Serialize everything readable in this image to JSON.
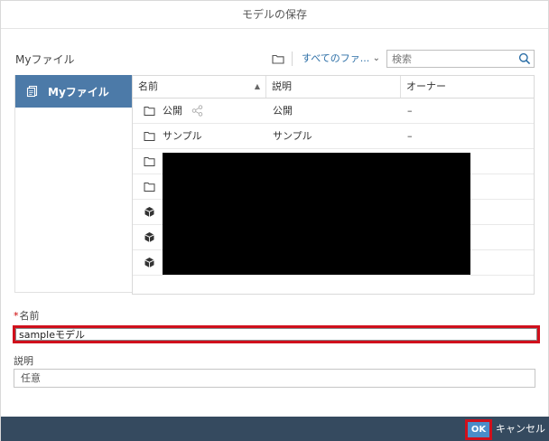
{
  "dialog": {
    "title": "モデルの保存"
  },
  "toolbar": {
    "location_label": "Myファイル",
    "filter_label": "すべてのファ...",
    "search_placeholder": "検索"
  },
  "sidebar": {
    "items": [
      {
        "label": "Myファイル",
        "icon": "document-icon",
        "selected": true
      }
    ]
  },
  "table": {
    "columns": [
      "名前",
      "説明",
      "オーナー"
    ],
    "rows": [
      {
        "icon": "folder-icon",
        "name": "公開",
        "shared": true,
        "description": "公開",
        "owner": "–"
      },
      {
        "icon": "folder-icon",
        "name": "サンプル",
        "shared": false,
        "description": "サンプル",
        "owner": "–"
      },
      {
        "icon": "folder-icon",
        "name": "",
        "description": "",
        "owner": ""
      },
      {
        "icon": "folder-icon",
        "name": "",
        "description": "",
        "owner": ""
      },
      {
        "icon": "model-cube-icon",
        "name": "",
        "description": "",
        "owner": ""
      },
      {
        "icon": "model-cube-icon",
        "name": "",
        "description": "",
        "owner": ""
      },
      {
        "icon": "model-cube-icon",
        "name": "",
        "description": "",
        "owner": ""
      }
    ]
  },
  "form": {
    "name_label": "名前",
    "required_mark": "*",
    "name_value": "sampleモデル",
    "description_label": "説明",
    "description_placeholder": "任意"
  },
  "footer": {
    "ok_label": "OK",
    "cancel_label": "キャンセル"
  },
  "colors": {
    "selected_sidebar": "#4c7aa8",
    "footer_bg": "#354a5f",
    "ok_button": "#4a8dc9",
    "highlight": "#d0101c",
    "link": "#2b6ea6"
  }
}
